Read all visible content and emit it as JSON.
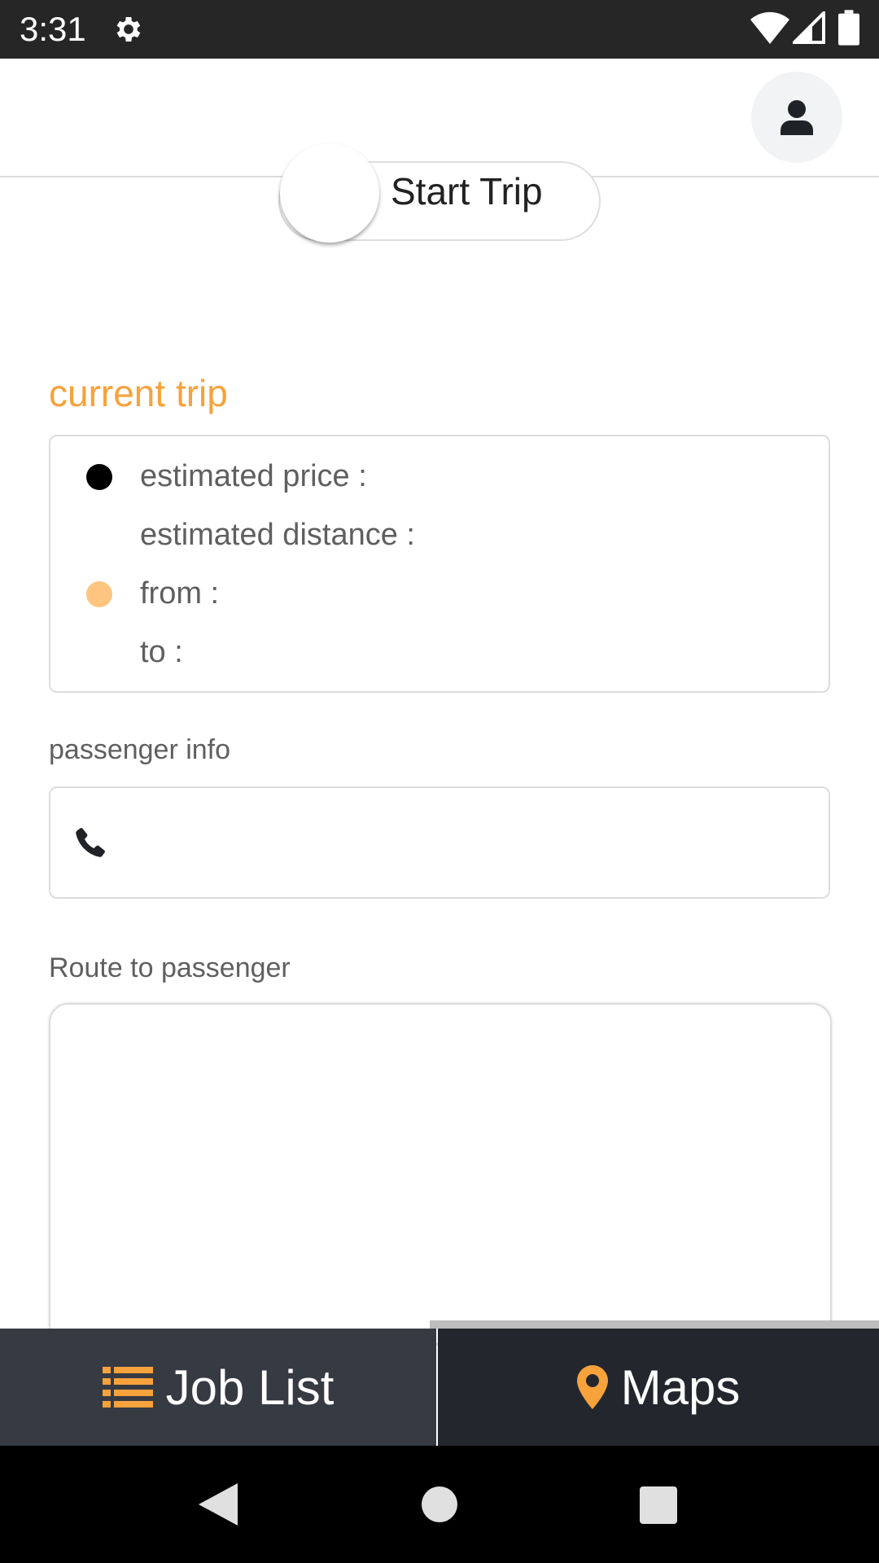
{
  "status_bar": {
    "time": "3:31",
    "icons": [
      "gear-icon",
      "wifi-icon",
      "signal-icon",
      "battery-icon"
    ]
  },
  "header": {
    "profile_icon": "user-icon"
  },
  "toggle": {
    "label": "Start Trip",
    "state": "off"
  },
  "current_trip": {
    "title": "current trip",
    "estimated_price_label": "estimated price :",
    "estimated_distance_label": "estimated distance :",
    "from_label": "from :",
    "to_label": "to :"
  },
  "passenger": {
    "title": "passenger info",
    "phone_icon": "phone-icon"
  },
  "route": {
    "title": "Route to passenger"
  },
  "bottom_nav": {
    "job_list": "Job List",
    "maps": "Maps"
  },
  "colors": {
    "accent": "#f7a23b",
    "orange_dot": "#fdc57f",
    "nav_left": "#363a43",
    "nav_right": "#23272d"
  }
}
